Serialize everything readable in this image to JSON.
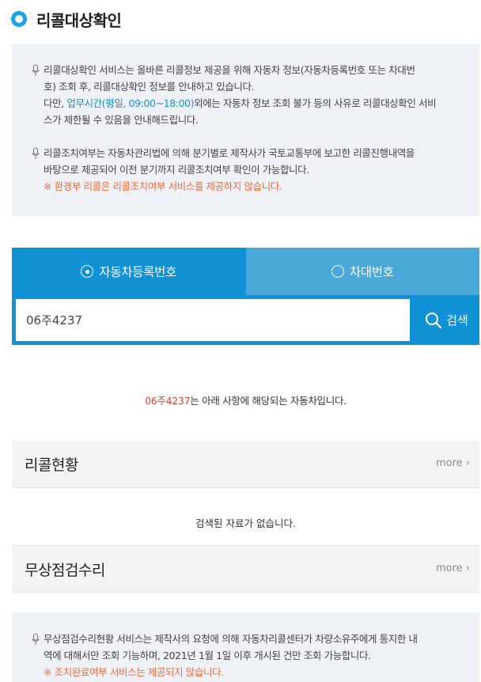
{
  "page": {
    "title": "리콜대상확인"
  },
  "notices": {
    "recall_service": {
      "line1": "리콜대상확인 서비스는 올바른 리콜정보 제공을 위해 자동차 정보(자동차등록번호 또는 차대번",
      "line2": "호) 조회 후, 리콜대상확인 정보를 안내하고 있습니다.",
      "line3_prefix": "다만, ",
      "line3_highlight": "업무시간(평일, 09:00~18:00)",
      "line3_suffix": "외에는 자동차 정보 조회 불가 등의 사유로 리콜대상확인 서비",
      "line4": "스가 제한될 수 있음을 안내해드립니다."
    },
    "recall_action": {
      "line1": "리콜조치여부는 자동차관리법에 의해 분기별로 제작사가 국토교통부에 보고한 리콜진행내역을",
      "line2": "바탕으로 제공되어 이전 분기까지 리콜조치여부 확인이 가능합니다.",
      "warning": "※ 환경부 리콜은 리콜조치여부 서비스를 제공하지 않습니다."
    },
    "free_repair": {
      "line1": "무상점검수리현황 서비스는 제작사의 요청에 의해 자동차리콜센터가 차량소유주에게 통지한 내",
      "line2": "역에 대해서만 조회 기능하며, 2021년 1월 1일 이후 개시된 건만 조회 가능합니다.",
      "warning": "※ 조치완료여부 서비스는 제공되지 않습니다."
    }
  },
  "tabs": [
    {
      "label": "자동차등록번호",
      "selected": true
    },
    {
      "label": "차대번호",
      "selected": false
    }
  ],
  "search": {
    "value": "06주4237",
    "button_label": "검색"
  },
  "result": {
    "plate": "06주4237",
    "message": "는 아래 사항에 해당되는 자동차입니다."
  },
  "sections": {
    "recall": {
      "title": "리콜현황",
      "more": "more"
    },
    "recall_empty": "검색된 자료가 없습니다.",
    "repair": {
      "title": "무상점검수리",
      "more": "more"
    }
  },
  "colors": {
    "accent": "#0f92d6",
    "tab_inactive": "#4aa9da",
    "highlight_blue": "#1a8fd6",
    "warning_orange": "#f26a3b",
    "plate_red": "#e8433a"
  }
}
